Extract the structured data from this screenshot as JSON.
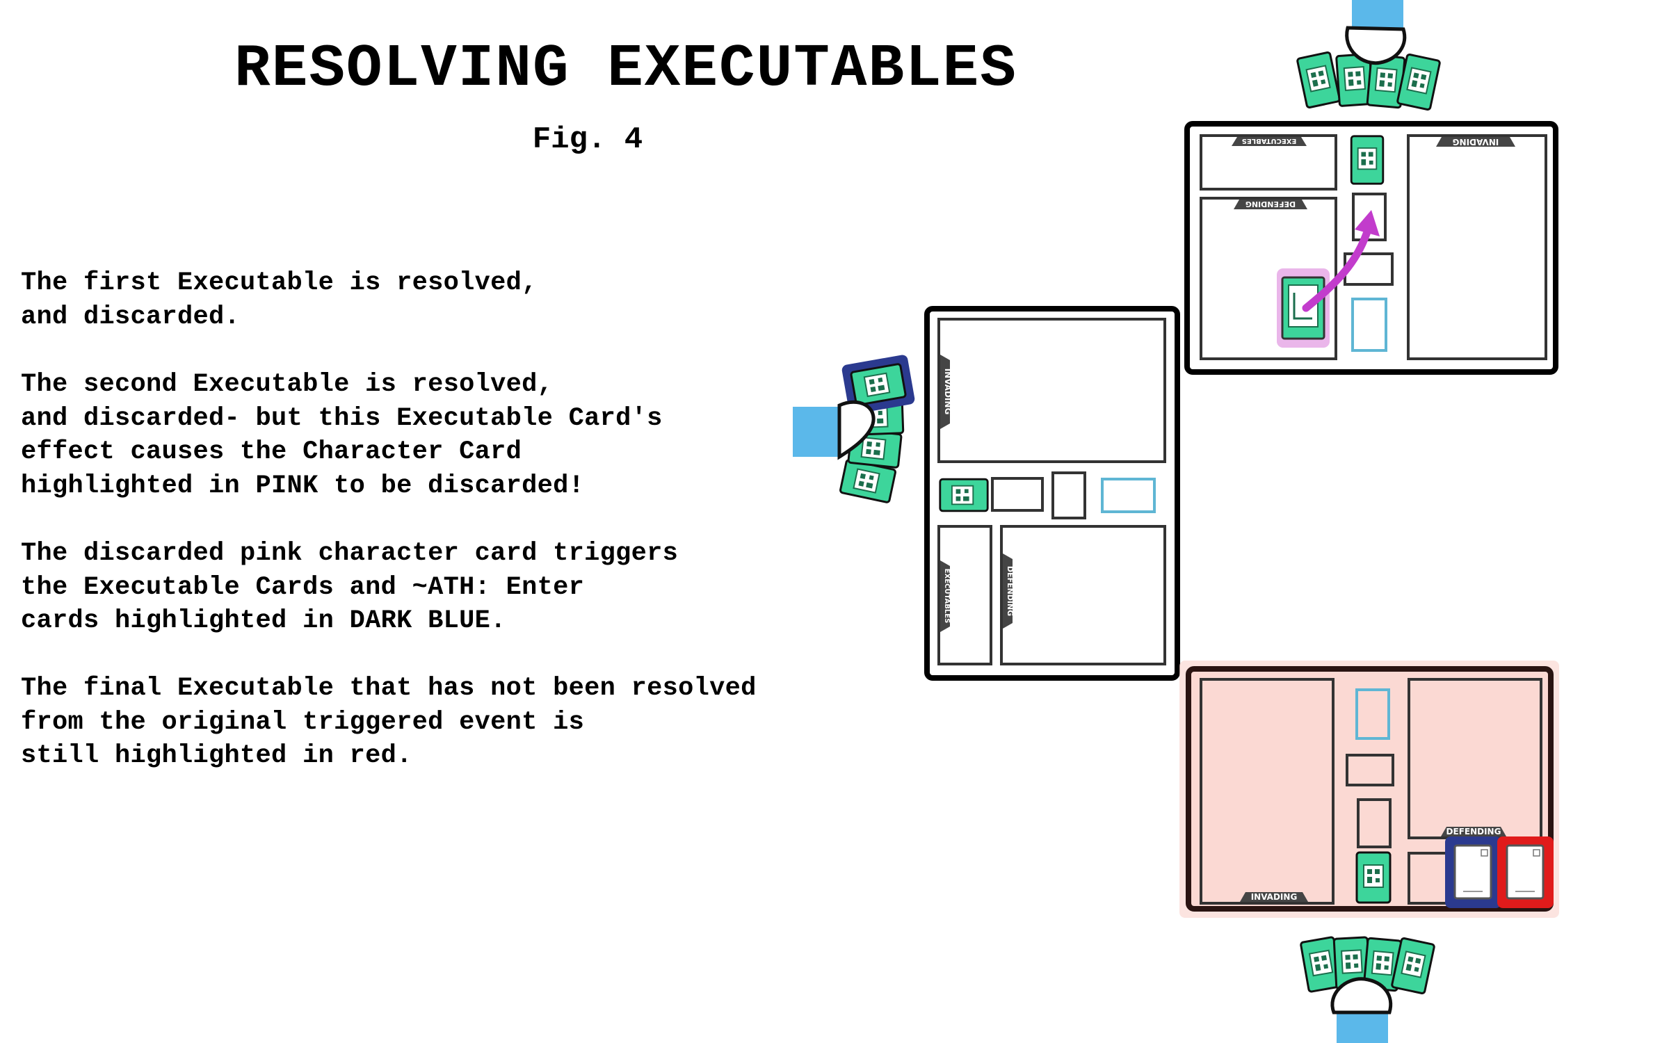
{
  "title": "RESOLVING EXECUTABLES",
  "figure_label": "Fig. 4",
  "paragraphs": [
    "The first Executable is resolved,\nand discarded.",
    "The second Executable is resolved,\nand discarded- but this Executable Card's\neffect causes the Character Card\nhighlighted in PINK to be discarded!",
    "The discarded pink character card triggers\nthe Executable Cards and ~ATH: Enter\ncards highlighted in DARK BLUE.",
    "The final Executable that has not been resolved\nfrom the original triggered event is\nstill highlighted in red."
  ],
  "zone_labels": {
    "invading": "INVADING",
    "defending": "DEFENDING",
    "executables": "EXECUTABLES"
  },
  "colors": {
    "pink_highlight": "#eab6ea",
    "arrow_magenta": "#c23ccc",
    "dark_blue": "#2b3a8f",
    "red": "#e01b1b",
    "card_green": "#3dd59b",
    "sleeve_blue": "#5bb8ea",
    "board_pink": "#fbd9d3",
    "board_dark": "#2a1412"
  }
}
